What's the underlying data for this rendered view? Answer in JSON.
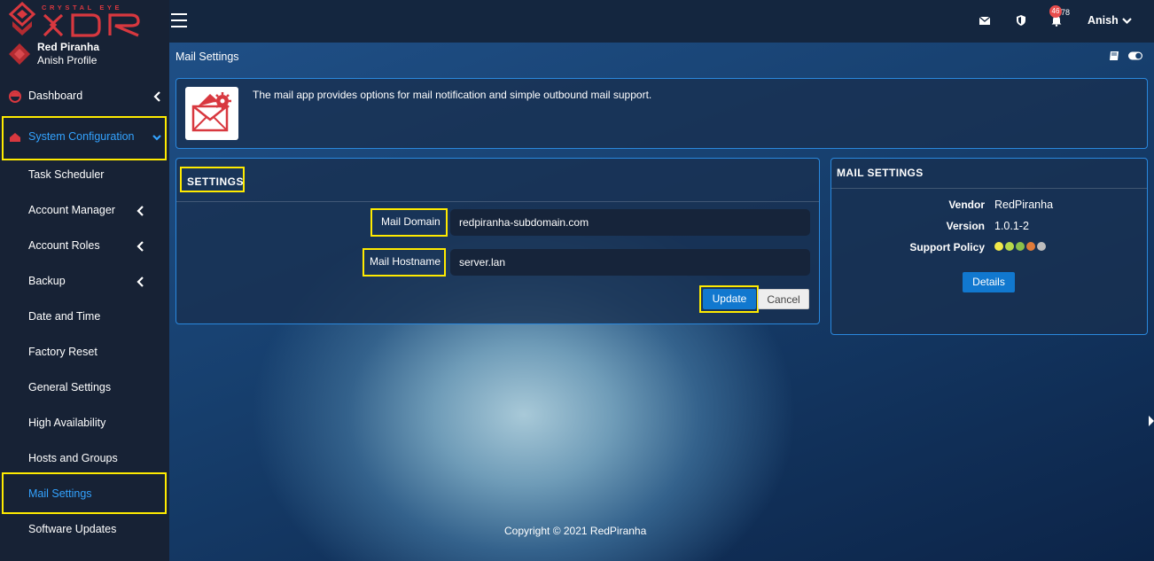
{
  "brand": {
    "tagline": "CRYSTAL EYE",
    "product": "XDR",
    "org_name": "Red Piranha",
    "profile_name": "Anish Profile",
    "accent_color": "#d8383f"
  },
  "sidebar": {
    "items": [
      {
        "label": "Dashboard",
        "icon": "dashboard-icon"
      },
      {
        "label": "System Configuration",
        "icon": "home-icon"
      },
      {
        "label": "Task Scheduler"
      },
      {
        "label": "Account Manager"
      },
      {
        "label": "Account Roles"
      },
      {
        "label": "Backup"
      },
      {
        "label": "Date and Time"
      },
      {
        "label": "Factory Reset"
      },
      {
        "label": "General Settings"
      },
      {
        "label": "High Availability"
      },
      {
        "label": "Hosts and Groups"
      },
      {
        "label": "Mail Settings"
      },
      {
        "label": "Software Updates"
      }
    ],
    "active_color": "#33a3ff",
    "highlight_color": "#ffeb00"
  },
  "topbar": {
    "icons": [
      "menu-icon",
      "mail-icon",
      "shield-icon",
      "bell-icon"
    ],
    "notif_badge": "46",
    "notif_count": "78",
    "user": "Anish"
  },
  "page": {
    "title": "Mail Settings",
    "intro": "The mail app provides options for mail notification and simple outbound mail support."
  },
  "settings": {
    "heading": "SETTINGS",
    "domain_label": "Mail Domain",
    "domain_value": "redpiranha-subdomain.com",
    "hostname_label": "Mail Hostname",
    "hostname_value": "server.lan",
    "update_label": "Update",
    "cancel_label": "Cancel"
  },
  "info": {
    "heading": "MAIL SETTINGS",
    "vendor_label": "Vendor",
    "vendor": "RedPiranha",
    "version_label": "Version",
    "version": "1.0.1-2",
    "policy_label": "Support Policy",
    "policy_colors": [
      "#f2e94a",
      "#b8d94a",
      "#8cc04a",
      "#e07b39",
      "#bdbdbd"
    ],
    "details_label": "Details"
  },
  "footer": {
    "copyright": "Copyright © 2021 RedPiranha"
  }
}
